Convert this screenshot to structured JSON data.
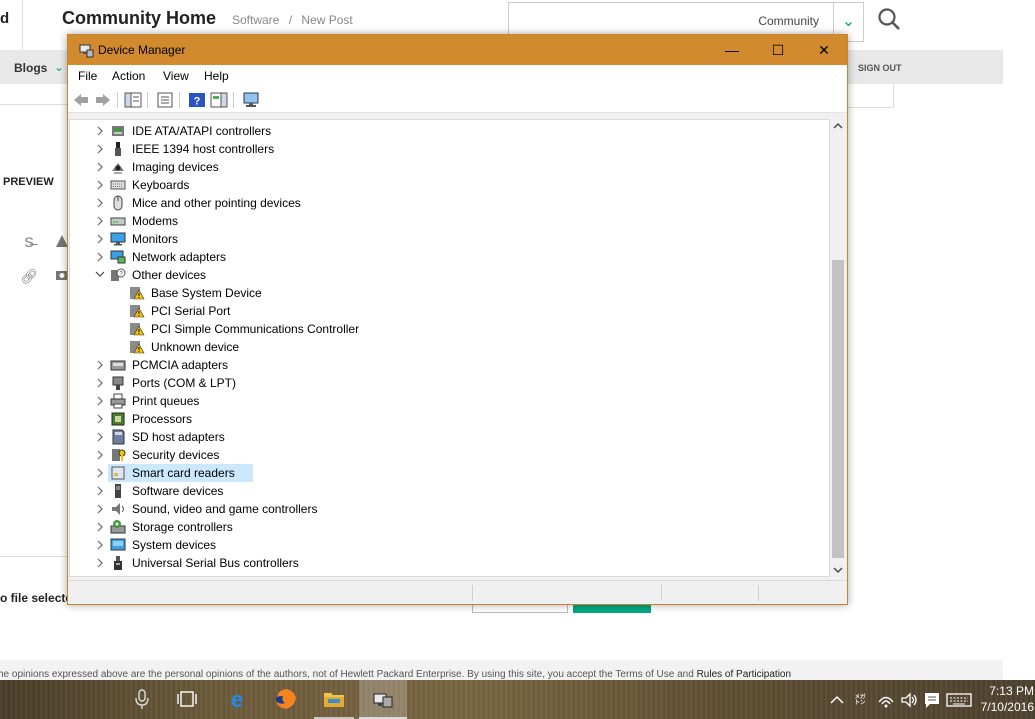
{
  "web": {
    "left_fragment": "d",
    "title": "Community Home",
    "breadcrumbs": [
      "Software",
      "/",
      "New Post"
    ],
    "search_scope": "Community",
    "nav_blogs": "Blogs",
    "nav_signout": "SIGN OUT",
    "preview_label": "PREVIEW",
    "file_status": "o file selected",
    "footer_text": "he opinions expressed above are the personal opinions of the authors, not of Hewlett Packard Enterprise. By using this site, you accept the Terms of Use and",
    "footer_link": "Rules of Participation",
    "accent_color": "#01a982"
  },
  "window": {
    "title": "Device Manager",
    "titlebar_color": "#d18a2e",
    "menu": [
      "File",
      "Action",
      "View",
      "Help"
    ],
    "controls": {
      "minimize": "—",
      "maximize": "☐",
      "close": "✕"
    }
  },
  "tree": [
    {
      "label": "IDE ATA/ATAPI controllers",
      "level": 0,
      "expanded": false,
      "icon": "ide-controller-icon"
    },
    {
      "label": "IEEE 1394 host controllers",
      "level": 0,
      "expanded": false,
      "icon": "ieee1394-icon"
    },
    {
      "label": "Imaging devices",
      "level": 0,
      "expanded": false,
      "icon": "camera-icon"
    },
    {
      "label": "Keyboards",
      "level": 0,
      "expanded": false,
      "icon": "keyboard-icon"
    },
    {
      "label": "Mice and other pointing devices",
      "level": 0,
      "expanded": false,
      "icon": "mouse-icon"
    },
    {
      "label": "Modems",
      "level": 0,
      "expanded": false,
      "icon": "modem-icon"
    },
    {
      "label": "Monitors",
      "level": 0,
      "expanded": false,
      "icon": "monitor-icon"
    },
    {
      "label": "Network adapters",
      "level": 0,
      "expanded": false,
      "icon": "network-adapter-icon"
    },
    {
      "label": "Other devices",
      "level": 0,
      "expanded": true,
      "icon": "other-devices-icon"
    },
    {
      "label": "Base System Device",
      "level": 1,
      "icon": "warning-device-icon"
    },
    {
      "label": "PCI Serial Port",
      "level": 1,
      "icon": "warning-device-icon"
    },
    {
      "label": "PCI Simple Communications Controller",
      "level": 1,
      "icon": "warning-device-icon"
    },
    {
      "label": "Unknown device",
      "level": 1,
      "icon": "warning-device-icon"
    },
    {
      "label": "PCMCIA adapters",
      "level": 0,
      "expanded": false,
      "icon": "pcmcia-icon"
    },
    {
      "label": "Ports (COM & LPT)",
      "level": 0,
      "expanded": false,
      "icon": "port-icon"
    },
    {
      "label": "Print queues",
      "level": 0,
      "expanded": false,
      "icon": "printer-icon"
    },
    {
      "label": "Processors",
      "level": 0,
      "expanded": false,
      "icon": "processor-icon"
    },
    {
      "label": "SD host adapters",
      "level": 0,
      "expanded": false,
      "icon": "sd-card-icon"
    },
    {
      "label": "Security devices",
      "level": 0,
      "expanded": false,
      "icon": "security-device-icon"
    },
    {
      "label": "Smart card readers",
      "level": 0,
      "expanded": false,
      "icon": "smart-card-icon",
      "selected": true
    },
    {
      "label": "Software devices",
      "level": 0,
      "expanded": false,
      "icon": "software-device-icon"
    },
    {
      "label": "Sound, video and game controllers",
      "level": 0,
      "expanded": false,
      "icon": "speaker-icon"
    },
    {
      "label": "Storage controllers",
      "level": 0,
      "expanded": false,
      "icon": "storage-controller-icon"
    },
    {
      "label": "System devices",
      "level": 0,
      "expanded": false,
      "icon": "system-device-icon"
    },
    {
      "label": "Universal Serial Bus controllers",
      "level": 0,
      "expanded": false,
      "icon": "usb-icon"
    }
  ],
  "taskbar": {
    "apps": [
      "microphone-icon",
      "task-view-icon",
      "edge-icon",
      "firefox-icon",
      "file-explorer-icon",
      "device-manager-icon"
    ],
    "active_app": "device-manager-icon",
    "time": "7:13 PM",
    "date": "7/10/2016"
  }
}
